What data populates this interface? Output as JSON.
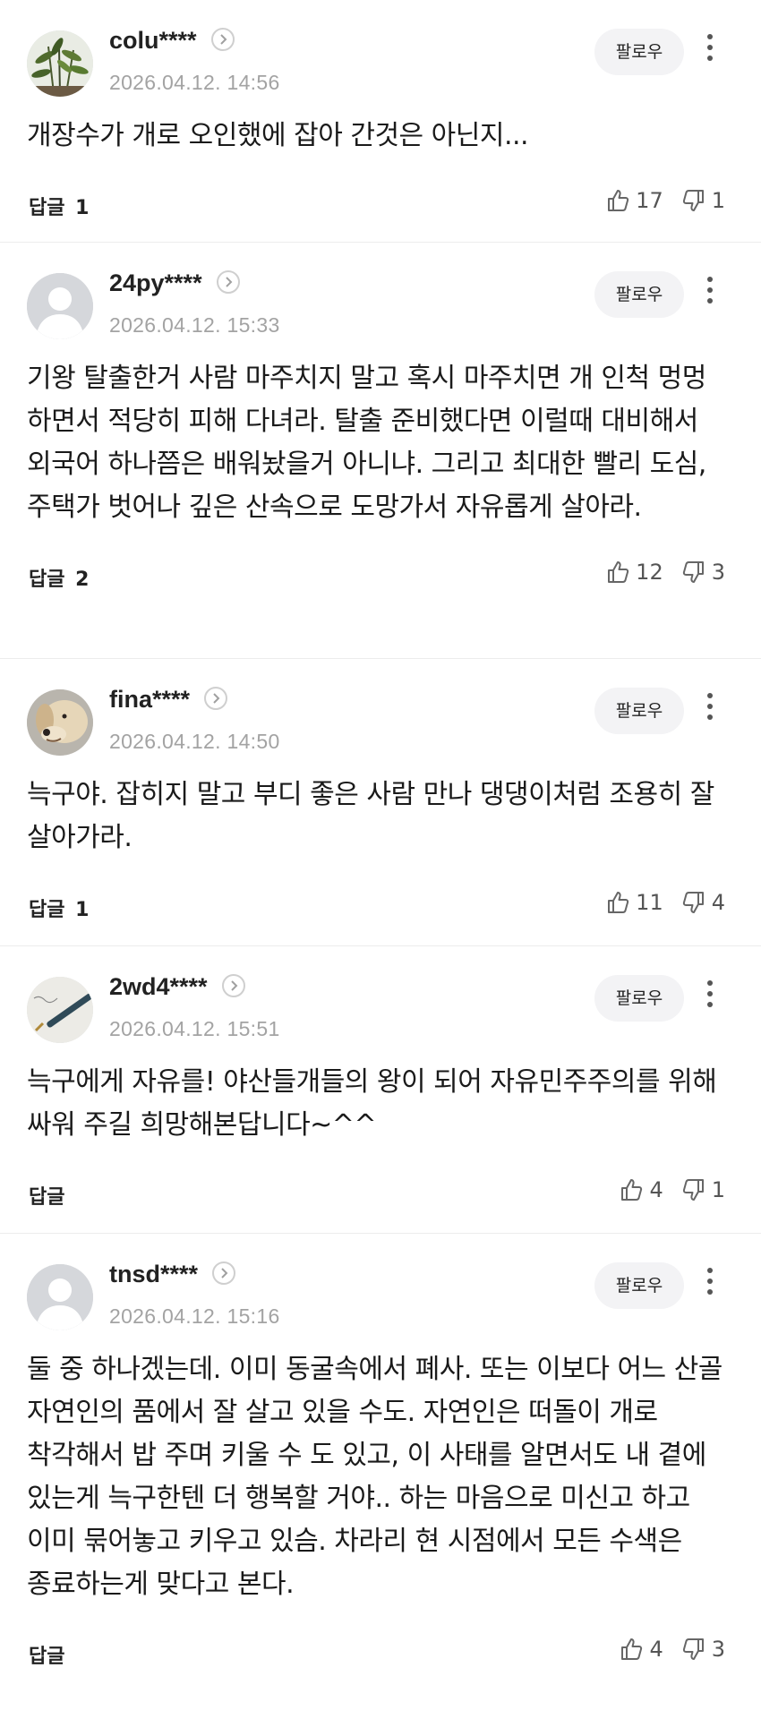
{
  "follow_label": "팔로우",
  "reply_label": "답글",
  "comments": [
    {
      "user": "colu****",
      "date": "2026.04.12. 14:56",
      "avatar": "plant-photo-avatar",
      "text": "개장수가 개로 오인했에 잡아 간것은 아닌지...",
      "replies": "1",
      "likes": "17",
      "dislikes": "1"
    },
    {
      "user": "24py****",
      "date": "2026.04.12. 15:33",
      "avatar": "default-avatar",
      "text": "기왕 탈출한거 사람 마주치지 말고 혹시 마주치면 개 인척 멍멍 하면서 적당히 피해 다녀라. 탈출 준비했다면 이럴때 대비해서 외국어 하나쯤은 배워놨을거 아니냐. 그리고 최대한 빨리 도심, 주택가 벗어나 깊은 산속으로 도망가서 자유롭게 살아라.",
      "replies": "2",
      "likes": "12",
      "dislikes": "3"
    },
    {
      "user": "fina****",
      "date": "2026.04.12. 14:50",
      "avatar": "dog-photo-avatar",
      "text": "늑구야. 잡히지 말고 부디 좋은 사람 만나 댕댕이처럼 조용히 잘 살아가라.",
      "replies": "1",
      "likes": "11",
      "dislikes": "4"
    },
    {
      "user": "2wd4****",
      "date": "2026.04.12. 15:51",
      "avatar": "pen-photo-avatar",
      "text": "늑구에게 자유를! 야산들개들의 왕이 되어 자유민주주의를 위해 싸워 주길 희망해본답니다~^^",
      "replies": "",
      "likes": "4",
      "dislikes": "1"
    },
    {
      "user": "tnsd****",
      "date": "2026.04.12. 15:16",
      "avatar": "default-avatar",
      "text": "둘 중 하나겠는데. 이미 동굴속에서 폐사. 또는 이보다 어느 산골 자연인의 품에서 잘 살고 있을 수도. 자연인은 떠돌이 개로 착각해서 밥 주며 키울 수 도 있고, 이 사태를 알면서도 내 곁에 있는게 늑구한텐 더 행복할 거야.. 하는 마음으로 미신고 하고 이미 묶어놓고 키우고 있슴. 차라리 현 시점에서 모든 수색은 종료하는게 맞다고 본다.",
      "replies": "",
      "likes": "4",
      "dislikes": "3"
    }
  ]
}
